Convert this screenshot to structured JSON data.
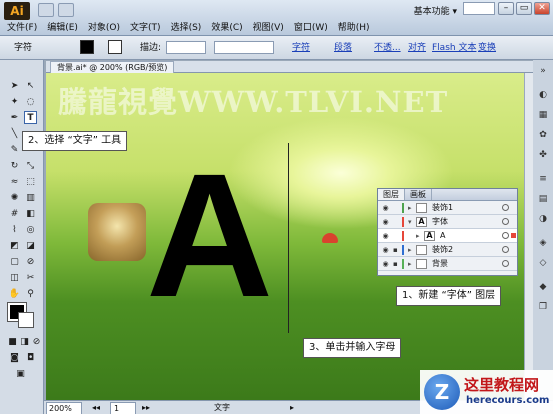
{
  "app": {
    "logo": "Ai",
    "workspace": "基本功能 ▾"
  },
  "window_buttons": {
    "minimize": "–",
    "restore": "▭",
    "close": "✕"
  },
  "menu": [
    "文件(F)",
    "编辑(E)",
    "对象(O)",
    "文字(T)",
    "选择(S)",
    "效果(C)",
    "视图(V)",
    "窗口(W)",
    "帮助(H)"
  ],
  "controlbar": {
    "type_label": "字符",
    "stroke_label": "描边:",
    "char_link": "字符",
    "para_link": "段落",
    "opacity_link": "不透...",
    "align_link": "对齐",
    "flash_link": "Flash 文本",
    "transform_link": "变换"
  },
  "document": {
    "tab": "背景.ai* @ 200% (RGB/预览)",
    "watermark": "騰龍視覺WWW.TLVI.NET",
    "big_letter": "A"
  },
  "statusbar": {
    "zoom": "200%",
    "page": "1",
    "tool": "文字"
  },
  "layers_panel": {
    "tabs": [
      "图层",
      "画板"
    ],
    "rows": [
      {
        "name": "装饰1",
        "thumb": "",
        "color": "#4fa34f",
        "expanded": false,
        "indent": 0,
        "selected": false
      },
      {
        "name": "字体",
        "thumb": "A",
        "color": "#e6473a",
        "expanded": true,
        "indent": 0,
        "selected": false
      },
      {
        "name": "A",
        "thumb": "A",
        "color": "#e6473a",
        "expanded": false,
        "indent": 1,
        "selected": true
      },
      {
        "name": "装饰2",
        "thumb": "",
        "color": "#2f6fd1",
        "expanded": false,
        "indent": 0,
        "selected": false
      },
      {
        "name": "背景",
        "thumb": "",
        "color": "#57b057",
        "expanded": false,
        "indent": 0,
        "selected": false
      }
    ]
  },
  "callouts": {
    "step2": "2、选择 “文字” 工具",
    "step1": "1、新建 “字体” 图层",
    "step3": "3、单击并输入字母"
  },
  "brand": {
    "name": "这里教程网",
    "url": "herecours.com",
    "logo": "Z"
  }
}
